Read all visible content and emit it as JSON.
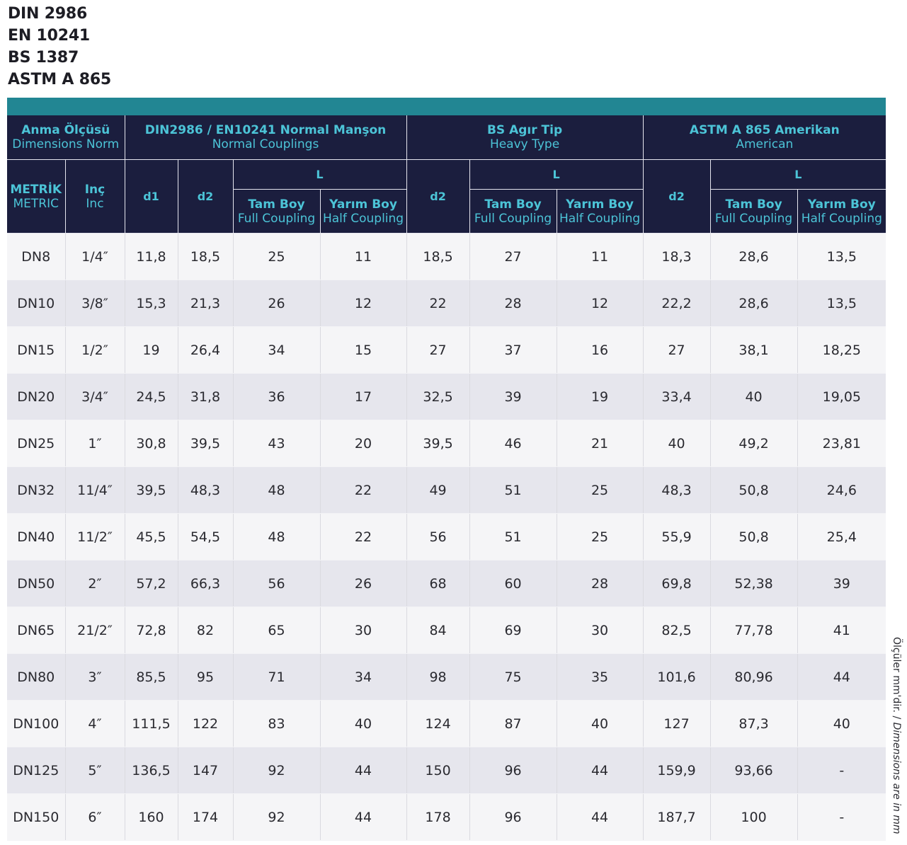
{
  "standards": [
    "DIN 2986",
    "EN 10241",
    "BS 1387",
    "ASTM A 865"
  ],
  "header": {
    "anma": {
      "bold": "Anma Ölçüsü",
      "sub": "Dimensions Norm"
    },
    "din": {
      "bold": "DIN2986 / EN10241 Normal Manşon",
      "sub": "Normal Couplings"
    },
    "bs": {
      "bold": "BS Agır Tip",
      "sub": "Heavy Type"
    },
    "astm": {
      "bold": "ASTM A 865 Amerikan",
      "sub": "American"
    },
    "metrik": {
      "bold": "METRİK",
      "sub": "METRIC"
    },
    "inc": {
      "bold": "Inç",
      "sub": "Inc"
    },
    "d1": "d1",
    "d2": "d2",
    "L": "L",
    "tam": {
      "bold": "Tam Boy",
      "sub": "Full Coupling"
    },
    "yarim": {
      "bold": "Yarım Boy",
      "sub": "Half Coupling"
    }
  },
  "rows": [
    [
      "DN8",
      "1/4″",
      "11,8",
      "18,5",
      "25",
      "11",
      "18,5",
      "27",
      "11",
      "18,3",
      "28,6",
      "13,5"
    ],
    [
      "DN10",
      "3/8″",
      "15,3",
      "21,3",
      "26",
      "12",
      "22",
      "28",
      "12",
      "22,2",
      "28,6",
      "13,5"
    ],
    [
      "DN15",
      "1/2″",
      "19",
      "26,4",
      "34",
      "15",
      "27",
      "37",
      "16",
      "27",
      "38,1",
      "18,25"
    ],
    [
      "DN20",
      "3/4″",
      "24,5",
      "31,8",
      "36",
      "17",
      "32,5",
      "39",
      "19",
      "33,4",
      "40",
      "19,05"
    ],
    [
      "DN25",
      "1″",
      "30,8",
      "39,5",
      "43",
      "20",
      "39,5",
      "46",
      "21",
      "40",
      "49,2",
      "23,81"
    ],
    [
      "DN32",
      "11/4″",
      "39,5",
      "48,3",
      "48",
      "22",
      "49",
      "51",
      "25",
      "48,3",
      "50,8",
      "24,6"
    ],
    [
      "DN40",
      "11/2″",
      "45,5",
      "54,5",
      "48",
      "22",
      "56",
      "51",
      "25",
      "55,9",
      "50,8",
      "25,4"
    ],
    [
      "DN50",
      "2″",
      "57,2",
      "66,3",
      "56",
      "26",
      "68",
      "60",
      "28",
      "69,8",
      "52,38",
      "39"
    ],
    [
      "DN65",
      "21/2″",
      "72,8",
      "82",
      "65",
      "30",
      "84",
      "69",
      "30",
      "82,5",
      "77,78",
      "41"
    ],
    [
      "DN80",
      "3″",
      "85,5",
      "95",
      "71",
      "34",
      "98",
      "75",
      "35",
      "101,6",
      "80,96",
      "44"
    ],
    [
      "DN100",
      "4″",
      "111,5",
      "122",
      "83",
      "40",
      "124",
      "87",
      "40",
      "127",
      "87,3",
      "40"
    ],
    [
      "DN125",
      "5″",
      "136,5",
      "147",
      "92",
      "44",
      "150",
      "96",
      "44",
      "159,9",
      "93,66",
      "-"
    ],
    [
      "DN150",
      "6″",
      "160",
      "174",
      "92",
      "44",
      "178",
      "96",
      "44",
      "187,7",
      "100",
      "-"
    ]
  ],
  "note": {
    "tr": "Ölçüler mm'dir. /",
    "en": "Dimensions are in mm"
  }
}
